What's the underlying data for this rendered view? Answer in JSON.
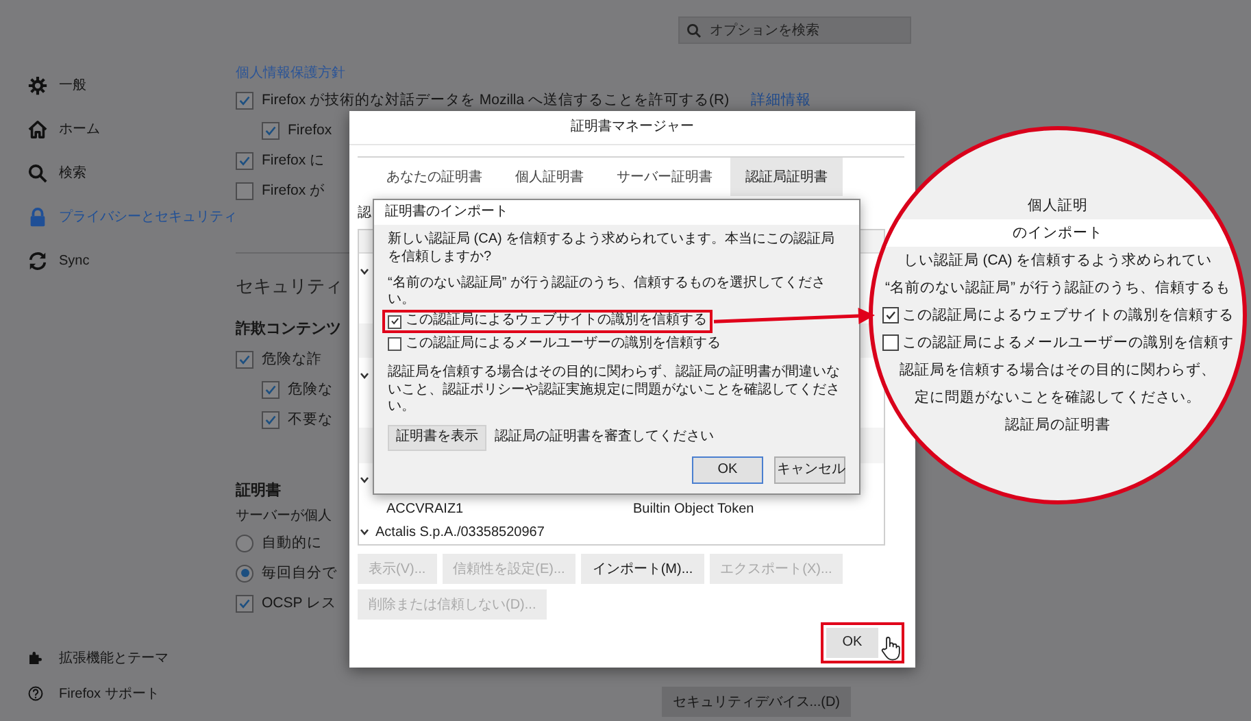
{
  "search": {
    "placeholder": "オプションを検索"
  },
  "sidebar": {
    "items": [
      {
        "label": "一般",
        "selected": false
      },
      {
        "label": "ホーム",
        "selected": false
      },
      {
        "label": "検索",
        "selected": false
      },
      {
        "label": "プライバシーとセキュリティ",
        "selected": true
      },
      {
        "label": "Sync",
        "selected": false
      }
    ],
    "footer": [
      {
        "label": "拡張機能とテーマ"
      },
      {
        "label": "Firefox サポート"
      }
    ]
  },
  "settings": [
    {
      "kind": "link-heading",
      "text": "個人情報保護方針"
    },
    {
      "kind": "checkbox",
      "label": "Firefox が技術的な対話データを Mozilla へ送信することを許可する(R)",
      "link": "詳細情報",
      "checked": true,
      "children": [
        {
          "kind": "checkbox",
          "label": "Firefox",
          "checked": true
        }
      ]
    },
    {
      "kind": "checkbox",
      "label": "Firefox に",
      "checked": true
    },
    {
      "kind": "checkbox",
      "label": "Firefox が",
      "checked": false
    },
    {
      "kind": "divider"
    },
    {
      "kind": "section",
      "text": "セキュリティ"
    },
    {
      "kind": "subheading",
      "text": "詐欺コンテンツ"
    },
    {
      "kind": "checkbox",
      "label": "危険な詐",
      "checked": true,
      "children": [
        {
          "kind": "checkbox",
          "label": "危険な",
          "checked": true
        },
        {
          "kind": "checkbox",
          "label": "不要な",
          "checked": true
        }
      ]
    },
    {
      "kind": "subheading",
      "text": "証明書"
    },
    {
      "kind": "text",
      "text": "サーバーが個人"
    },
    {
      "kind": "radio",
      "label": "自動的に",
      "selected": false
    },
    {
      "kind": "radio",
      "label": "毎回自分で",
      "selected": true
    },
    {
      "kind": "checkbox",
      "label": "OCSP レス",
      "checked": true
    },
    {
      "kind": "button",
      "label": "セキュリティデバイス...(D)"
    }
  ],
  "certificate_manager": {
    "title": "証明書マネージャー",
    "tabs": [
      {
        "label": "あなたの証明書",
        "selected": false
      },
      {
        "label": "個人証明書",
        "selected": false
      },
      {
        "label": "サーバー証明書",
        "selected": false
      },
      {
        "label": "認証局証明書",
        "selected": true
      }
    ],
    "description": "認",
    "rows": [
      {
        "kind": "group",
        "expanded": true
      },
      {
        "kind": "cert"
      },
      {
        "kind": "cert"
      },
      {
        "kind": "group",
        "expanded": true
      },
      {
        "kind": "cert"
      },
      {
        "kind": "cert"
      },
      {
        "kind": "group",
        "expanded": true
      },
      {
        "kind": "cert",
        "name": "ACCVRAIZ1",
        "device": "Builtin Object Token"
      },
      {
        "kind": "group",
        "name": "Actalis S.p.A./03358520967",
        "expanded": true
      }
    ],
    "buttons": [
      {
        "label": "表示(V)...",
        "disabled": true
      },
      {
        "label": "信頼性を設定(E)...",
        "disabled": true
      },
      {
        "label": "インポート(M)...",
        "disabled": false
      },
      {
        "label": "エクスポート(X)...",
        "disabled": true
      },
      {
        "label": "削除または信頼しない(D)...",
        "disabled": true
      }
    ],
    "ok": {
      "label": "OK",
      "highlighted": true
    }
  },
  "import_dialog": {
    "title": "証明書のインポート",
    "message": "新しい認証局 (CA) を信頼するよう求められています。本当にこの認証局を信頼しますか?",
    "prompt": "“名前のない認証局” が行う認証のうち、信頼するものを選択してください。",
    "options": [
      {
        "label": "この認証局によるウェブサイトの識別を信頼する",
        "checked": true,
        "highlighted": true
      },
      {
        "label": "この認証局によるメールユーザーの識別を信頼する",
        "checked": false,
        "highlighted": false
      }
    ],
    "note": "認証局を信頼する場合はその目的に関わらず、認証局の証明書が間違いないこと、認証ポリシーや認証実施規定に問題がないことを確認してください。",
    "view_button": "証明書を表示",
    "view_hint": "認証局の証明書を審査してください",
    "buttons": [
      {
        "label": "OK",
        "default": true
      },
      {
        "label": "キャンセル",
        "default": false
      }
    ]
  },
  "magnifier": {
    "tab": "個人証明",
    "title": "のインポート",
    "message": "しい認証局 (CA) を信頼するよう求められてい",
    "prompt": "“名前のない認証局” が行う認証のうち、信頼するも",
    "options": [
      {
        "label": "この認証局によるウェブサイトの識別を信頼する",
        "checked": true
      },
      {
        "label": "この認証局によるメールユーザーの識別を信頼す",
        "checked": false
      }
    ],
    "note_lines": [
      "認証局を信頼する場合はその目的に関わらず、",
      "定に問題がないことを確認してください。"
    ],
    "hint": "認証局の証明書"
  }
}
